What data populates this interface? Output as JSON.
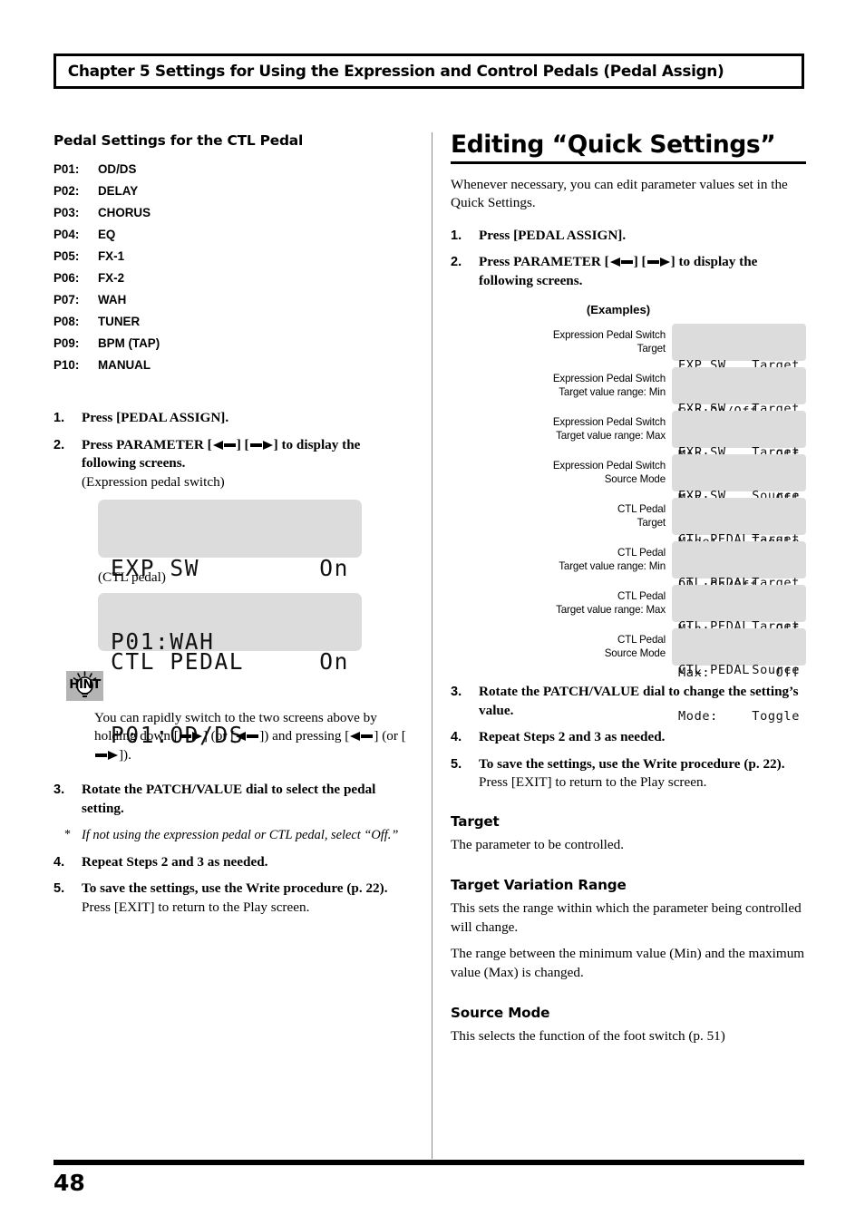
{
  "chapter": {
    "banner": "Chapter 5 Settings for Using the Expression and Control Pedals (Pedal Assign)"
  },
  "left": {
    "heading": "Pedal Settings for the CTL Pedal",
    "pedal_list": [
      {
        "code": "P01:",
        "name": "OD/DS"
      },
      {
        "code": "P02:",
        "name": "DELAY"
      },
      {
        "code": "P03:",
        "name": "CHORUS"
      },
      {
        "code": "P04:",
        "name": "EQ"
      },
      {
        "code": "P05:",
        "name": "FX-1"
      },
      {
        "code": "P06:",
        "name": "FX-2"
      },
      {
        "code": "P07:",
        "name": "WAH"
      },
      {
        "code": "P08:",
        "name": "TUNER"
      },
      {
        "code": "P09:",
        "name": "BPM (TAP)"
      },
      {
        "code": "P10:",
        "name": "MANUAL"
      }
    ],
    "steps": {
      "n1": "1.",
      "s1": "Press [PEDAL ASSIGN].",
      "n2": "2.",
      "s2_a": "Press PARAMETER [",
      "s2_b": "] [",
      "s2_c": "] to display the following screens.",
      "s2_sub": "(Expression pedal switch)",
      "n3": "3.",
      "s3": "Rotate the PATCH/VALUE dial to select the pedal setting.",
      "note_star": "*",
      "note": "If not using the expression pedal or CTL pedal, select “Off.”",
      "n4": "4.",
      "s4": "Repeat Steps 2 and 3 as needed.",
      "n5": "5.",
      "s5": "To save the settings, use the Write procedure (p. 22).",
      "s5_sub": "Press [EXIT] to return to the Play screen."
    },
    "lcd_exp_caption": "(Expression pedal switch)",
    "lcd_exp": {
      "line1_left": "EXP SW",
      "line1_right": "On",
      "line2": "P01:WAH"
    },
    "lcd_ctl_caption": "(CTL pedal)",
    "lcd_ctl": {
      "line1_left": "CTL PEDAL",
      "line1_right": "On",
      "line2": "P01:OD/DS"
    },
    "hint": {
      "badge": "HINT",
      "text_a": "You can rapidly switch to the two screens above by holding down [",
      "text_b": "] (or [",
      "text_c": "]) and pressing [",
      "text_d": "] (or [",
      "text_e": "])."
    }
  },
  "right": {
    "heading": "Editing “Quick Settings”",
    "intro": "Whenever necessary, you can edit parameter values set in the Quick Settings.",
    "steps": {
      "n1": "1.",
      "s1": "Press [PEDAL ASSIGN].",
      "n2": "2.",
      "s2_a": "Press PARAMETER [",
      "s2_b": "] [",
      "s2_c": "] to display the following screens.",
      "n3": "3.",
      "s3": "Rotate the PATCH/VALUE dial to change the setting’s value.",
      "n4": "4.",
      "s4": "Repeat Steps 2 and 3 as needed.",
      "n5": "5.",
      "s5": "To save the settings, use the Write procedure (p. 22).",
      "s5_sub": "Press [EXIT] to return to the Play screen."
    },
    "examples_title": "(Examples)",
    "examples": [
      {
        "label": "Expression Pedal Switch\nTarget",
        "line1_left": "EXP SW",
        "line1_right": "Target",
        "line2_left": "wah:On/Off",
        "line2_right": ""
      },
      {
        "label": "Expression Pedal Switch\nTarget value range: Min",
        "line1_left": "EXP SW",
        "line1_right": "Target",
        "line2_left": "Min:",
        "line2_right": "Off"
      },
      {
        "label": "Expression Pedal Switch\nTarget value range: Max",
        "line1_left": "EXP SW",
        "line1_right": "Target",
        "line2_left": "Max:",
        "line2_right": "Off"
      },
      {
        "label": "Expression Pedal Switch\nSource Mode",
        "line1_left": "EXP SW",
        "line1_right": "Source",
        "line2_left": "Mode:",
        "line2_right": "Toggle"
      },
      {
        "label": "CTL Pedal\nTarget",
        "line1_left": "CTL PEDAL",
        "line1_right": "Target",
        "line2_left": "OD :On/Off",
        "line2_right": ""
      },
      {
        "label": "CTL Pedal\nTarget value range: Min",
        "line1_left": "CTL PEDAL",
        "line1_right": "Target",
        "line2_left": "Min:",
        "line2_right": "Off"
      },
      {
        "label": "CTL Pedal\nTarget value range: Max",
        "line1_left": "CTL PEDAL",
        "line1_right": "Target",
        "line2_left": "Max:",
        "line2_right": "Off"
      },
      {
        "label": "CTL Pedal\nSource Mode",
        "line1_left": "CTL PEDAL",
        "line1_right": "Source",
        "line2_left": "Mode:",
        "line2_right": "Toggle"
      }
    ],
    "sections": [
      {
        "heading": "Target",
        "body1": "The parameter to be controlled.",
        "body2": ""
      },
      {
        "heading": "Target Variation Range",
        "body1": "This sets the range within which the parameter being controlled will change.",
        "body2": "The range between the minimum value (Min) and the maximum value (Max) is changed."
      },
      {
        "heading": "Source Mode",
        "body1": "This selects the function of the foot switch (p. 51)",
        "body2": ""
      }
    ]
  },
  "footer": {
    "page_number": "48"
  }
}
